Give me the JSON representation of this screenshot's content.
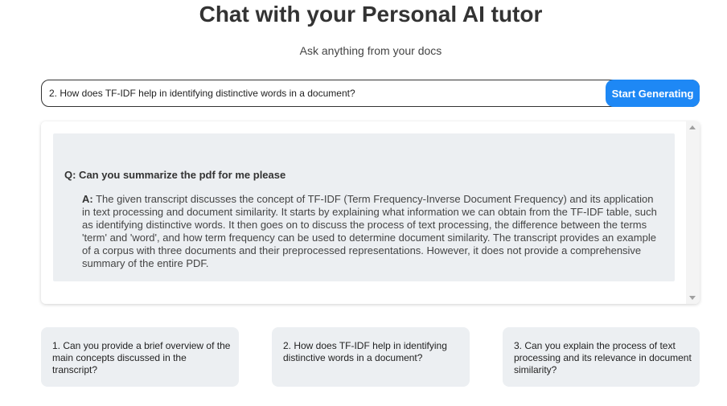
{
  "header": {
    "title": "Chat with your Personal AI tutor",
    "subtitle": "Ask anything from your docs"
  },
  "query": {
    "value": "2. How does TF-IDF help in identifying distinctive words in a document?",
    "button_label": "Start Generating"
  },
  "chat": {
    "question": "Q: Can you summarize the pdf for me please",
    "answer_label": "A:",
    "answer_text": "The given transcript discusses the concept of TF-IDF (Term Frequency-Inverse Document Frequency) and its application in text processing and document similarity. It starts by explaining what information we can obtain from the TF-IDF table, such as identifying distinctive words. It then goes on to discuss the process of text processing, the difference between the terms 'term' and 'word', and how term frequency can be used to determine document similarity. The transcript provides an example of a corpus with three documents and their preprocessed representations. However, it does not provide a comprehensive summary of the entire PDF."
  },
  "suggestions": [
    "1. Can you provide a brief overview of the main concepts discussed in the transcript?",
    "2. How does TF-IDF help in identifying distinctive words in a document?",
    "3. Can you explain the process of text processing and its relevance in document similarity?"
  ],
  "colors": {
    "accent": "#1e88f5",
    "panel": "#eceff2"
  }
}
